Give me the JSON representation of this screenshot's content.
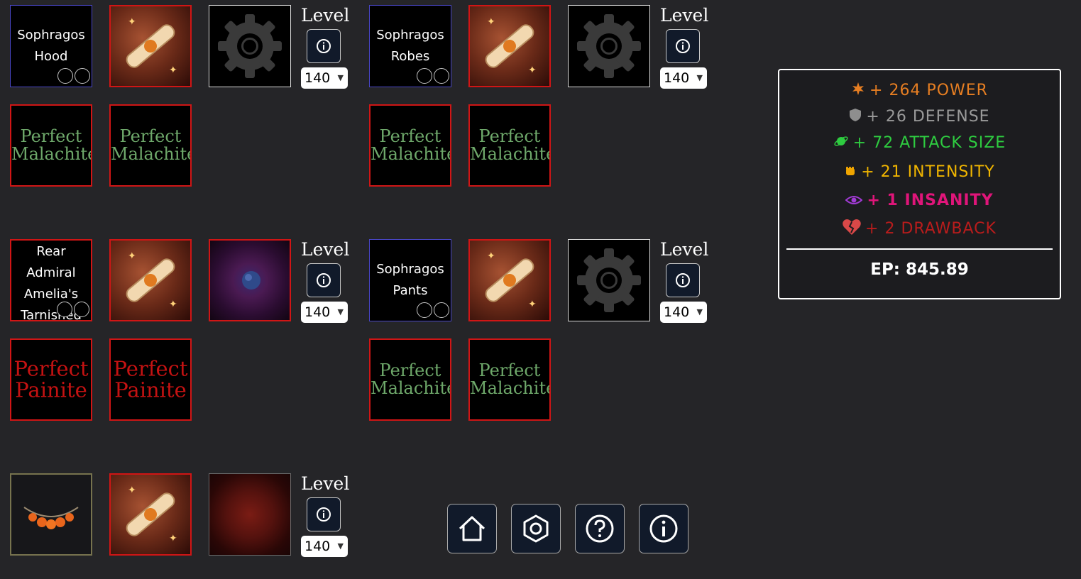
{
  "level_label": "Level",
  "level_value": "140",
  "gear": {
    "hood": {
      "name": "Sophragos Hood"
    },
    "robes": {
      "name": "Sophragos Robes"
    },
    "cloak": {
      "name": "Rear Admiral Amelia's Tarnished Cloak"
    },
    "pants": {
      "name": "Sophragos Pants"
    }
  },
  "gems": {
    "malachite": "Perfect Malachite",
    "painite": "Perfect Painite"
  },
  "stats": {
    "power": "+ 264 POWER",
    "defense": "+ 26 DEFENSE",
    "attack_size": "+ 72 ATTACK SIZE",
    "intensity": "+ 21 INTENSITY",
    "insanity": "+ 1 INSANITY",
    "drawback": "+ 2 DRAWBACK"
  },
  "ep": "EP: 845.89",
  "icons": [
    "info-icon",
    "gear-icon",
    "scroll-icon",
    "amulet-icon",
    "home-icon",
    "settings-icon",
    "help-icon",
    "power-icon",
    "shield-icon",
    "planet-icon",
    "fist-icon",
    "eye-icon",
    "broken-heart-icon"
  ],
  "colors": {
    "power": "#e67e22",
    "defense": "#9a9a9a",
    "attack_size": "#2ecc40",
    "intensity": "#f0b500",
    "insanity": "#e0157a",
    "drawback": "#b91c1c"
  }
}
